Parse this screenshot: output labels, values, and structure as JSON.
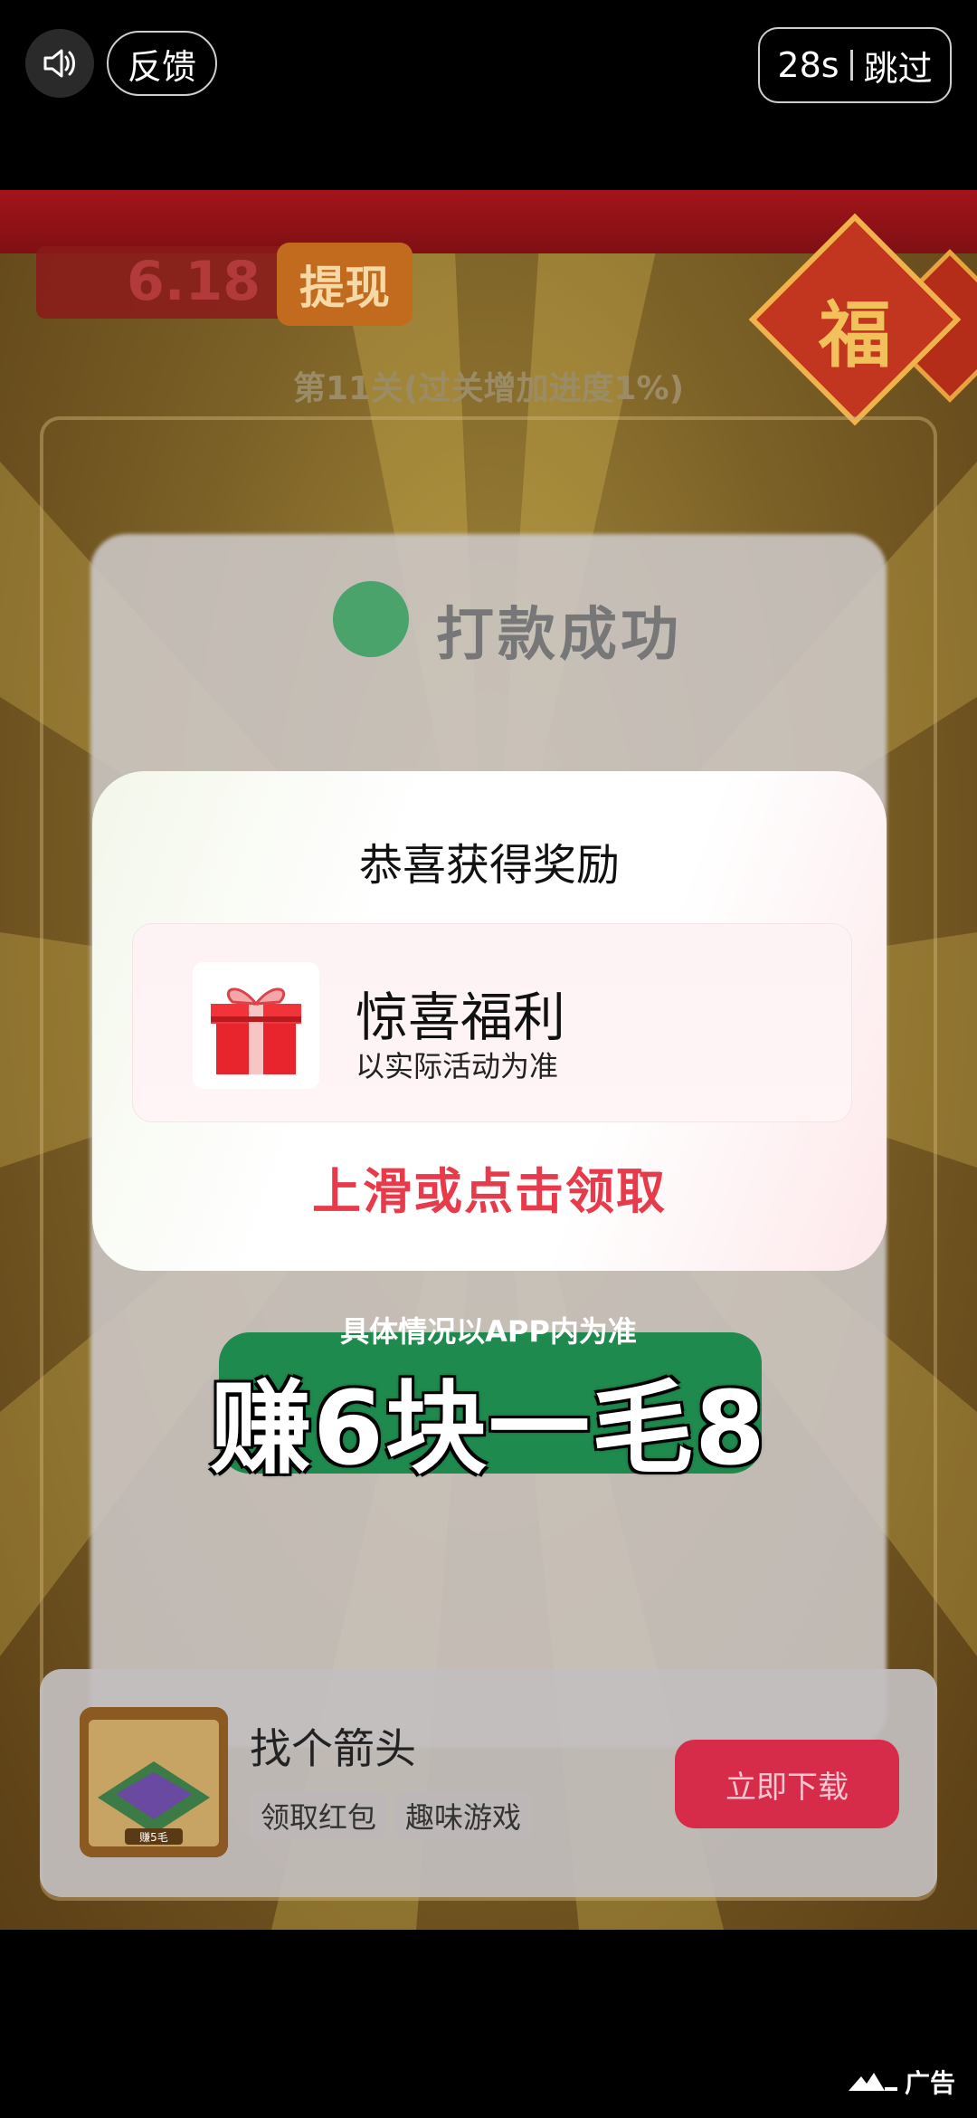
{
  "topbar": {
    "feedback_label": "反馈",
    "countdown": "28s",
    "skip_label": "跳过"
  },
  "game": {
    "balance": "6.18",
    "withdraw_label": "提现",
    "level_text": "第11关(过关增加进度1%)",
    "fu_char": "福",
    "blurred_title": "打款成功",
    "earn_text": "赚6块一毛8",
    "detail_note": "具体情况以APP内为准"
  },
  "modal": {
    "title": "恭喜获得奖励",
    "reward_name": "惊喜福利",
    "reward_sub": "以实际活动为准",
    "claim_label": "上滑或点击领取"
  },
  "appcard": {
    "name": "找个箭头",
    "tags": [
      "领取红包",
      "趣味游戏"
    ],
    "download_label": "立即下载",
    "icon_caption": "赚5毛"
  },
  "ad_label": "广告",
  "colors": {
    "claim_red": "#e83a4a",
    "download_red": "#d62c4a"
  }
}
